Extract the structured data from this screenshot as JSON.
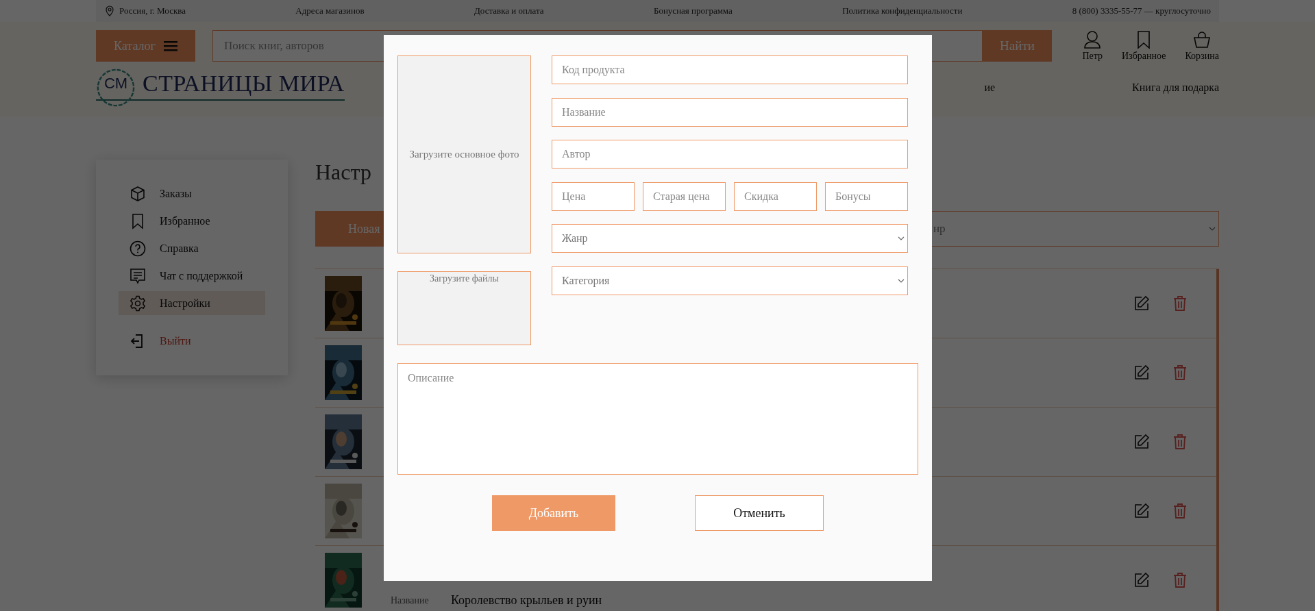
{
  "top_bar": {
    "location": "Россия, г. Москва",
    "links": [
      "Адреса магазинов",
      "Доставка и оплата",
      "Бонусная программа",
      "Политика конфиденциальности"
    ],
    "phone": "8 (800) 3335-55-77 — круглосуточно"
  },
  "header": {
    "catalog_button": "Каталог",
    "search": {
      "placeholder": "Поиск книг, авторов"
    },
    "search_button": "Найти",
    "user_links": [
      {
        "label": "Петр",
        "kind": "user"
      },
      {
        "label": "Избранное",
        "kind": "bookmark"
      },
      {
        "label": "Корзина",
        "kind": "basket"
      }
    ]
  },
  "logo": {
    "mark": "СМ",
    "name": "СТРАНИЦЫ МИРА"
  },
  "nav": [
    "ие",
    "Книга для подарка"
  ],
  "sidebar": {
    "items": [
      {
        "label": "Заказы",
        "kind": "box",
        "selected": false
      },
      {
        "label": "Избранное",
        "kind": "bookmark",
        "selected": false
      },
      {
        "label": "Справка",
        "kind": "help",
        "selected": false
      },
      {
        "label": "Чат с поддержкой",
        "kind": "chat",
        "selected": false
      },
      {
        "label": "Настройки",
        "kind": "settings",
        "selected": true
      },
      {
        "label": "Выйти",
        "kind": "logout",
        "selected": false
      }
    ]
  },
  "page_title": "Настр",
  "new_button": "Новая",
  "genre_filter": {
    "placeholder": "нр"
  },
  "products": [
    {
      "cover": {
        "kind": "picture"
      }
    },
    {
      "cover": {
        "kind": "picture"
      }
    },
    {
      "cover": {
        "kind": "picture"
      }
    },
    {
      "cover": {
        "kind": "picture"
      }
    },
    {
      "cover": {
        "kind": "picture"
      },
      "details": [
        {
          "label": "Название",
          "value": "Королевство крыльев и руин"
        }
      ]
    }
  ],
  "modal": {
    "photo_upload": "Загрузите основное фото",
    "files_upload": "Загрузите файлы",
    "fields": [
      {
        "placeholder": "Код продукта"
      },
      {
        "placeholder": "Название"
      },
      {
        "placeholder": "Автор"
      }
    ],
    "price_fields": [
      {
        "placeholder": "Цена"
      },
      {
        "placeholder": "Старая цена"
      },
      {
        "placeholder": "Скидка"
      },
      {
        "placeholder": "Бонусы"
      }
    ],
    "selects": [
      {
        "placeholder": "Жанр"
      },
      {
        "placeholder": "Категория"
      }
    ],
    "description": {
      "placeholder": "Описание"
    },
    "buttons": [
      {
        "label": "Добавить",
        "kind": "primary"
      },
      {
        "label": "Отменить",
        "kind": "secondary"
      }
    ]
  }
}
